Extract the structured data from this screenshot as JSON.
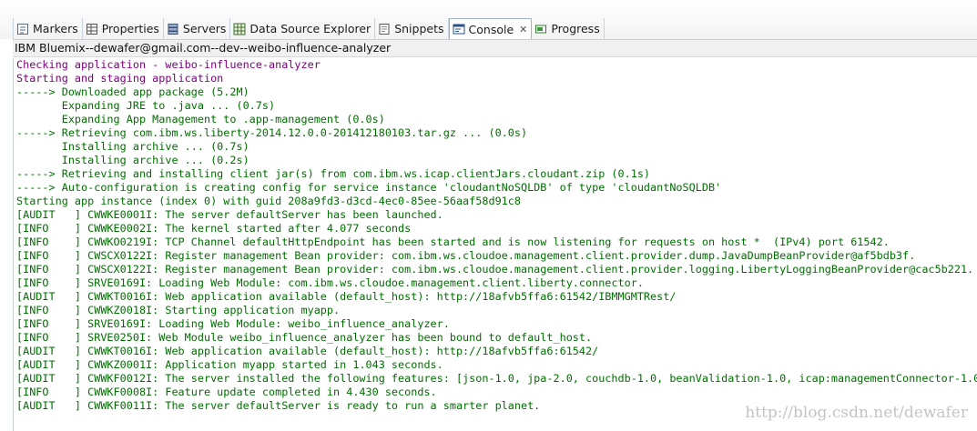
{
  "tabs": [
    {
      "label": "Markers",
      "icon": "markers-icon",
      "active": false
    },
    {
      "label": "Properties",
      "icon": "properties-icon",
      "active": false
    },
    {
      "label": "Servers",
      "icon": "servers-icon",
      "active": false
    },
    {
      "label": "Data Source Explorer",
      "icon": "data-source-icon",
      "active": false
    },
    {
      "label": "Snippets",
      "icon": "snippets-icon",
      "active": false
    },
    {
      "label": "Console",
      "icon": "console-icon",
      "active": true,
      "close": "✕"
    },
    {
      "label": "Progress",
      "icon": "progress-icon",
      "active": false
    }
  ],
  "console_title": "IBM Bluemix--dewafer@gmail.com--dev--weibo-influence-analyzer",
  "console_lines": [
    {
      "text": "Checking application - weibo-influence-analyzer",
      "color": "purple"
    },
    {
      "text": "Starting and staging application",
      "color": "purple"
    },
    {
      "text": "-----> Downloaded app package (5.2M)",
      "color": "green"
    },
    {
      "text": "       Expanding JRE to .java ... (0.7s)",
      "color": "green"
    },
    {
      "text": "       Expanding App Management to .app-management (0.0s)",
      "color": "green"
    },
    {
      "text": "-----> Retrieving com.ibm.ws.liberty-2014.12.0.0-201412180103.tar.gz ... (0.0s)",
      "color": "green"
    },
    {
      "text": "       Installing archive ... (0.7s)",
      "color": "green"
    },
    {
      "text": "       Installing archive ... (0.2s)",
      "color": "green"
    },
    {
      "text": "-----> Retrieving and installing client jar(s) from com.ibm.ws.icap.clientJars.cloudant.zip (0.1s)",
      "color": "green"
    },
    {
      "text": "-----> Auto-configuration is creating config for service instance 'cloudantNoSQLDB' of type 'cloudantNoSQLDB'",
      "color": "green"
    },
    {
      "text": "Starting app instance (index 0) with guid 208a9fd3-d3cd-4ec0-85ee-56aaf58d91c8",
      "color": "green"
    },
    {
      "text": "[AUDIT   ] CWWKE0001I: The server defaultServer has been launched.",
      "color": "green"
    },
    {
      "text": "[INFO    ] CWWKE0002I: The kernel started after 4.077 seconds",
      "color": "green"
    },
    {
      "text": "[INFO    ] CWWKO0219I: TCP Channel defaultHttpEndpoint has been started and is now listening for requests on host *  (IPv4) port 61542.",
      "color": "green"
    },
    {
      "text": "[INFO    ] CWSCX0122I: Register management Bean provider: com.ibm.ws.cloudoe.management.client.provider.dump.JavaDumpBeanProvider@af5bdb3f.",
      "color": "green"
    },
    {
      "text": "[INFO    ] CWSCX0122I: Register management Bean provider: com.ibm.ws.cloudoe.management.client.provider.logging.LibertyLoggingBeanProvider@cac5b221.",
      "color": "green"
    },
    {
      "text": "[INFO    ] SRVE0169I: Loading Web Module: com.ibm.ws.cloudoe.management.client.liberty.connector.",
      "color": "green"
    },
    {
      "text": "[AUDIT   ] CWWKT0016I: Web application available (default_host): http://18afvb5ffa6:61542/IBMMGMTRest/",
      "color": "green"
    },
    {
      "text": "[INFO    ] CWWKZ0018I: Starting application myapp.",
      "color": "green"
    },
    {
      "text": "[INFO    ] SRVE0169I: Loading Web Module: weibo_influence_analyzer.",
      "color": "green"
    },
    {
      "text": "[INFO    ] SRVE0250I: Web Module weibo_influence_analyzer has been bound to default_host.",
      "color": "green"
    },
    {
      "text": "[AUDIT   ] CWWKT0016I: Web application available (default_host): http://18afvb5ffa6:61542/",
      "color": "green"
    },
    {
      "text": "[AUDIT   ] CWWKZ0001I: Application myapp started in 1.043 seconds.",
      "color": "green"
    },
    {
      "text": "[AUDIT   ] CWWKF0012I: The server installed the following features: [json-1.0, jpa-2.0, couchdb-1.0, beanValidation-1.0, icap:managementConnector-1.0, ",
      "color": "green"
    },
    {
      "text": "[INFO    ] CWWKF0008I: Feature update completed in 4.430 seconds.",
      "color": "green"
    },
    {
      "text": "[AUDIT   ] CWWKF0011I: The server defaultServer is ready to run a smarter planet.",
      "color": "green"
    }
  ],
  "watermark": "http://blog.csdn.net/dewafer",
  "colors": {
    "purple": "#800080",
    "green": "#006f00"
  }
}
